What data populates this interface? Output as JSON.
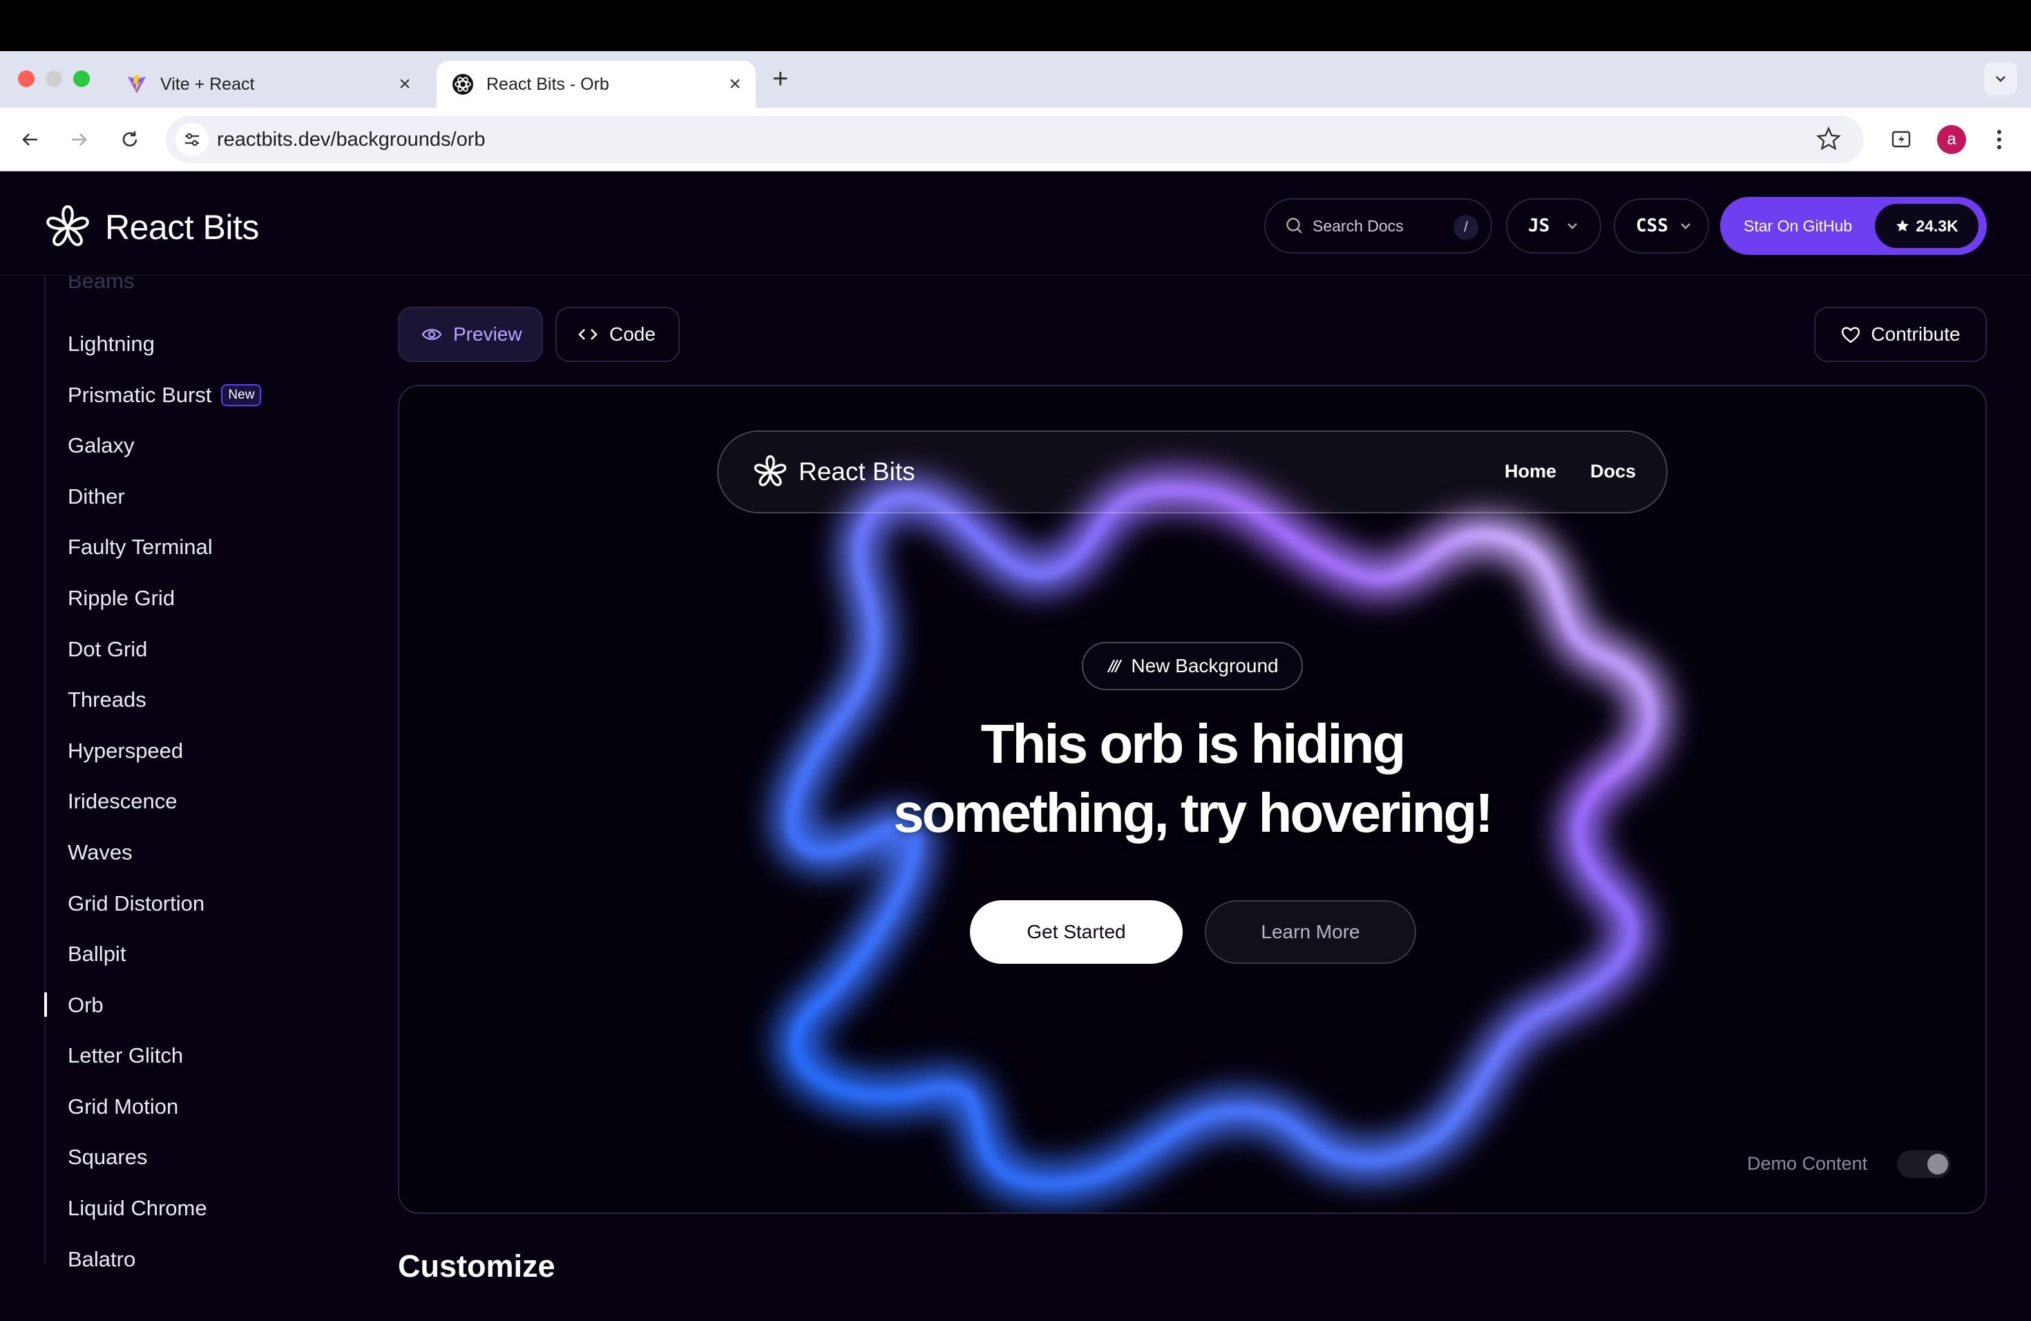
{
  "browser": {
    "tabs": [
      {
        "title": "Vite + React",
        "active": false,
        "favicon": "vite-logo"
      },
      {
        "title": "React Bits - Orb",
        "active": true,
        "favicon": "react-bits-logo"
      }
    ],
    "new_tab_label": "+",
    "url": "reactbits.dev/backgrounds/orb",
    "profile_initial": "a"
  },
  "header": {
    "brand": "React Bits",
    "search_placeholder": "Search Docs",
    "search_shortcut": "/",
    "language": "JS",
    "style": "CSS",
    "github_label": "Star On GitHub",
    "github_stars": "24.3K",
    "accent_color": "#6d3ff0"
  },
  "sidebar": {
    "partial_item": "Beams",
    "items": [
      {
        "label": "Lightning"
      },
      {
        "label": "Prismatic Burst",
        "badge": "New"
      },
      {
        "label": "Galaxy"
      },
      {
        "label": "Dither"
      },
      {
        "label": "Faulty Terminal"
      },
      {
        "label": "Ripple Grid"
      },
      {
        "label": "Dot Grid"
      },
      {
        "label": "Threads"
      },
      {
        "label": "Hyperspeed"
      },
      {
        "label": "Iridescence"
      },
      {
        "label": "Waves"
      },
      {
        "label": "Grid Distortion"
      },
      {
        "label": "Ballpit"
      },
      {
        "label": "Orb",
        "active": true
      },
      {
        "label": "Letter Glitch"
      },
      {
        "label": "Grid Motion"
      },
      {
        "label": "Squares"
      },
      {
        "label": "Liquid Chrome"
      },
      {
        "label": "Balatro"
      }
    ]
  },
  "main": {
    "tabs": {
      "preview": "Preview",
      "code": "Code"
    },
    "contribute": "Contribute",
    "demo": {
      "brand": "React Bits",
      "nav": [
        "Home",
        "Docs"
      ],
      "badge": "New Background",
      "headline_line1": "This orb is hiding",
      "headline_line2": "something, try hovering!",
      "primary_cta": "Get Started",
      "secondary_cta": "Learn More",
      "toggle_label": "Demo Content",
      "toggle_on": true
    },
    "section_title": "Customize"
  }
}
